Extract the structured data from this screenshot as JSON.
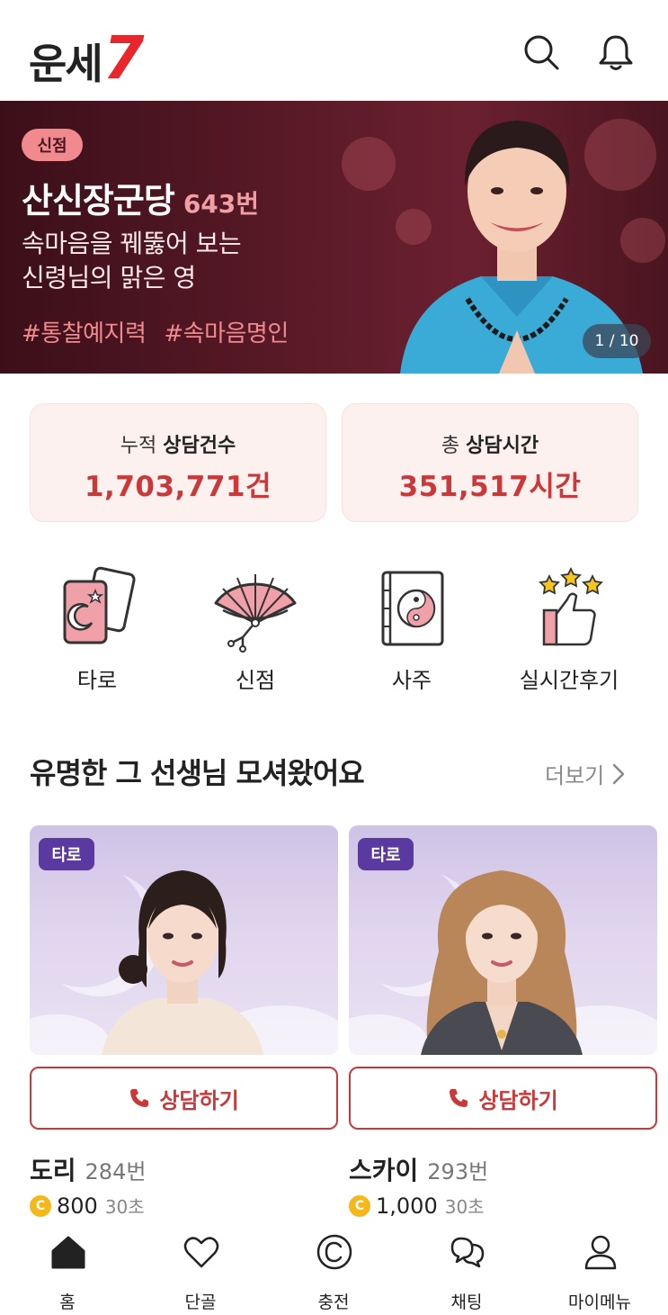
{
  "header": {
    "logo_text": "운세",
    "logo_number": "7"
  },
  "banner": {
    "badge": "신점",
    "name": "산신장군당",
    "number": "643번",
    "desc_line1": "속마음을 꿰뚫어 보는",
    "desc_line2": "신령님의 맑은 영",
    "tags": [
      "#통찰예지력",
      "#속마음명인"
    ],
    "page": "1 / 10"
  },
  "stats": [
    {
      "label_prefix": "누적",
      "label_bold": "상담건수",
      "value": "1,703,771건"
    },
    {
      "label_prefix": "총",
      "label_bold": "상담시간",
      "value": "351,517시간"
    }
  ],
  "categories": [
    {
      "label": "타로",
      "icon": "tarot-cards-icon"
    },
    {
      "label": "신점",
      "icon": "fan-icon"
    },
    {
      "label": "사주",
      "icon": "yin-yang-book-icon"
    },
    {
      "label": "실시간후기",
      "icon": "thumbs-up-stars-icon"
    }
  ],
  "section": {
    "title": "유명한 그 선생님 모셔왔어요",
    "more": "더보기"
  },
  "cards": [
    {
      "tag": "타로",
      "button": "상담하기",
      "name": "도리",
      "number": "284번",
      "price": "800",
      "time": "30초"
    },
    {
      "tag": "타로",
      "button": "상담하기",
      "name": "스카이",
      "number": "293번",
      "price": "1,000",
      "time": "30초"
    }
  ],
  "nav": [
    {
      "label": "홈",
      "icon": "home-icon"
    },
    {
      "label": "단골",
      "icon": "heart-icon"
    },
    {
      "label": "충전",
      "icon": "copyright-coin-icon"
    },
    {
      "label": "채팅",
      "icon": "chat-bubbles-icon"
    },
    {
      "label": "마이메뉴",
      "icon": "person-icon"
    }
  ],
  "colors": {
    "brand_red": "#e8262b",
    "accent_red": "#c9393a",
    "tag_purple": "#5a3aa0",
    "banner_bg": "#4a1520",
    "stat_bg": "#fdf1f0",
    "coin_yellow": "#f5b81a"
  }
}
